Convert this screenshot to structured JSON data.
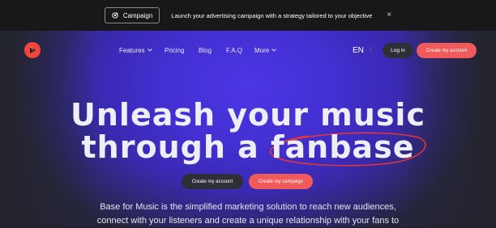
{
  "announcement": {
    "chip_label": "Campaign",
    "text": "Launch your advertising campaign with a strategy tailored to your objective",
    "close_glyph": "×"
  },
  "nav": {
    "items": [
      {
        "label": "Features",
        "has_dropdown": true
      },
      {
        "label": "Pricing",
        "has_dropdown": false
      },
      {
        "label": "Blog",
        "has_dropdown": false
      },
      {
        "label": "F.A.Q",
        "has_dropdown": false
      },
      {
        "label": "More",
        "has_dropdown": true
      }
    ],
    "language": "EN",
    "login_label": "Log in",
    "create_account_label": "Create my account"
  },
  "hero": {
    "line1": "Unleash your music",
    "line2_prefix": "through a ",
    "line2_highlight": "fanbase",
    "cta_account": "Create my account",
    "cta_campaign": "Create my campaign",
    "description_line1": "Base for Music is the simplified marketing solution to reach new audiences,",
    "description_line2": "connect with your listeners and create a unique relationship with your fans to"
  },
  "colors": {
    "accent": "#f15a5a",
    "hero_purple": "#4330d2",
    "dark_button": "#2f2f37",
    "logo_red": "#f0463c"
  },
  "icons": {
    "chip_icon": "target-icon",
    "logo": "play-logo-icon",
    "close": "close-icon",
    "dropdown": "chevron-down-icon"
  }
}
